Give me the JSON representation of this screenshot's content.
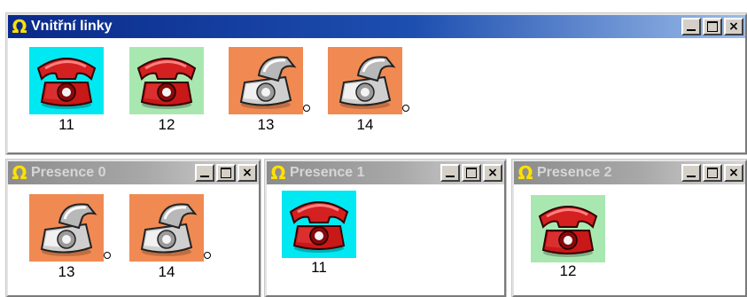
{
  "colors": {
    "tile_cyan": "#00e8f2",
    "tile_green": "#a8e8b0",
    "tile_orange": "#f08a52",
    "phone_red": "#c81818",
    "phone_grey": "#c8c8c8",
    "title_active": "#0a2a8a",
    "title_inactive": "#a0a0a0"
  },
  "windows": [
    {
      "title": "Vnitřní linky",
      "phones": [
        {
          "number": "11",
          "icon": "red-phone-icon",
          "tile": "cyan"
        },
        {
          "number": "12",
          "icon": "red-phone-icon",
          "tile": "green"
        },
        {
          "number": "13",
          "icon": "grey-phone-off-hook-icon",
          "tile": "orange"
        },
        {
          "number": "14",
          "icon": "grey-phone-off-hook-icon",
          "tile": "orange"
        }
      ]
    },
    {
      "title": "Presence 0",
      "phones": [
        {
          "number": "13",
          "icon": "grey-phone-off-hook-icon",
          "tile": "orange"
        },
        {
          "number": "14",
          "icon": "grey-phone-off-hook-icon",
          "tile": "orange"
        }
      ]
    },
    {
      "title": "Presence 1",
      "phones": [
        {
          "number": "11",
          "icon": "red-phone-icon",
          "tile": "cyan"
        }
      ]
    },
    {
      "title": "Presence 2",
      "phones": [
        {
          "number": "12",
          "icon": "red-phone-icon",
          "tile": "green"
        }
      ]
    }
  ],
  "controls": {
    "minimize": "_",
    "maximize": "",
    "close": "×"
  }
}
